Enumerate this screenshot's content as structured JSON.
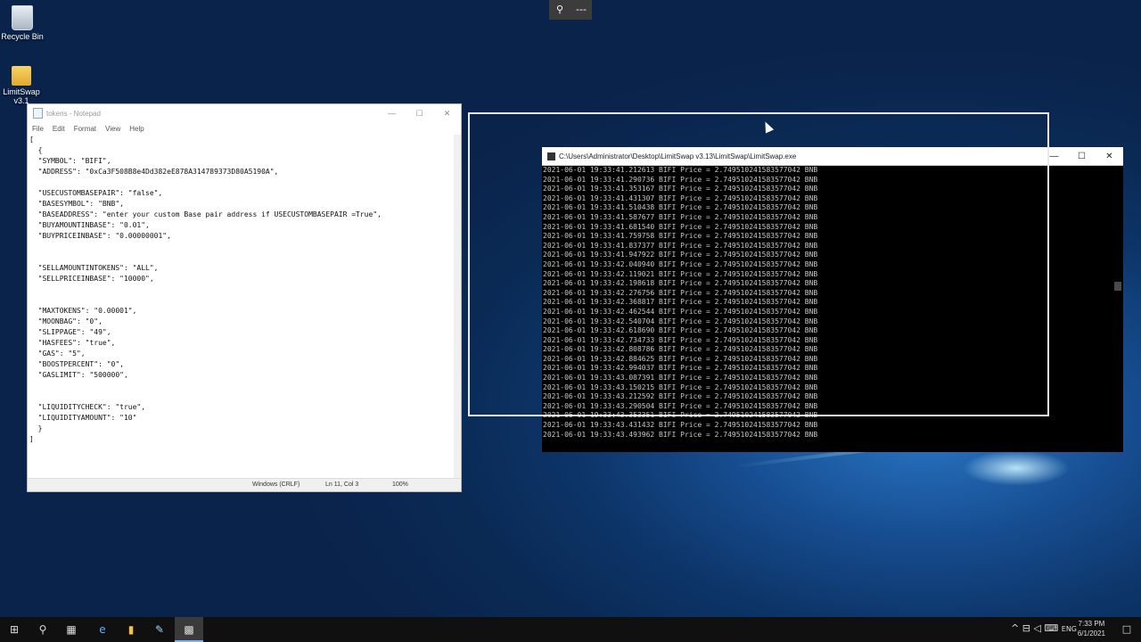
{
  "desktop": {
    "icons": [
      {
        "label": "Recycle Bin"
      },
      {
        "label": "LimitSwap v3.1"
      }
    ]
  },
  "remote_toolbar": {
    "zoom_icon": "zoom-icon",
    "more_label": "---"
  },
  "notepad": {
    "title": "tokens - Notepad",
    "menu": [
      "File",
      "Edit",
      "Format",
      "View",
      "Help"
    ],
    "content": "[\n  {\n  \"SYMBOL\": \"BIFI\",\n  \"ADDRESS\": \"0xCa3F508B8e4Dd382eE878A314789373D80A5190A\",\n\n  \"USECUSTOMBASEPAIR\": \"false\",\n  \"BASESYMBOL\": \"BNB\",\n  \"BASEADDRESS\": \"enter your custom Base pair address if USECUSTOMBASEPAIR =True\",\n  \"BUYAMOUNTINBASE\": \"0.01\",\n  \"BUYPRICEINBASE\": \"0.00000001\",\n\n\n  \"SELLAMOUNTINTOKENS\": \"ALL\",\n  \"SELLPRICEINBASE\": \"10000\",\n\n\n  \"MAXTOKENS\": \"0.00001\",\n  \"MOONBAG\": \"0\",\n  \"SLIPPAGE\": \"49\",\n  \"HASFEES\": \"true\",\n  \"GAS\": \"5\",\n  \"BOOSTPERCENT\": \"0\",\n  \"GASLIMIT\": \"500000\",\n\n\n  \"LIQUIDITYCHECK\": \"true\",\n  \"LIQUIDITYAMOUNT\": \"10\"\n  }\n]",
    "status": {
      "encoding": "Windows (CRLF)",
      "position": "Ln 11, Col 3",
      "zoom": "100%"
    }
  },
  "console": {
    "title": "C:\\Users\\Administrator\\Desktop\\LimitSwap v3.13\\LimitSwap\\LimitSwap.exe",
    "lines": "2021-06-01 19:33:41.212613 BIFI Price = 2.749510241583577042 BNB\n2021-06-01 19:33:41.290736 BIFI Price = 2.749510241583577042 BNB\n2021-06-01 19:33:41.353167 BIFI Price = 2.749510241583577042 BNB\n2021-06-01 19:33:41.431307 BIFI Price = 2.749510241583577042 BNB\n2021-06-01 19:33:41.510438 BIFI Price = 2.749510241583577042 BNB\n2021-06-01 19:33:41.587677 BIFI Price = 2.749510241583577042 BNB\n2021-06-01 19:33:41.681540 BIFI Price = 2.749510241583577042 BNB\n2021-06-01 19:33:41.759758 BIFI Price = 2.749510241583577042 BNB\n2021-06-01 19:33:41.837377 BIFI Price = 2.749510241583577042 BNB\n2021-06-01 19:33:41.947922 BIFI Price = 2.749510241583577042 BNB\n2021-06-01 19:33:42.040940 BIFI Price = 2.749510241583577042 BNB\n2021-06-01 19:33:42.119021 BIFI Price = 2.749510241583577042 BNB\n2021-06-01 19:33:42.198618 BIFI Price = 2.749510241583577042 BNB\n2021-06-01 19:33:42.276756 BIFI Price = 2.749510241583577042 BNB\n2021-06-01 19:33:42.368817 BIFI Price = 2.749510241583577042 BNB\n2021-06-01 19:33:42.462544 BIFI Price = 2.749510241583577042 BNB\n2021-06-01 19:33:42.540704 BIFI Price = 2.749510241583577042 BNB\n2021-06-01 19:33:42.618690 BIFI Price = 2.749510241583577042 BNB\n2021-06-01 19:33:42.734733 BIFI Price = 2.749510241583577042 BNB\n2021-06-01 19:33:42.808786 BIFI Price = 2.749510241583577042 BNB\n2021-06-01 19:33:42.884625 BIFI Price = 2.749510241583577042 BNB\n2021-06-01 19:33:42.994037 BIFI Price = 2.749510241583577042 BNB\n2021-06-01 19:33:43.087391 BIFI Price = 2.749510241583577042 BNB\n2021-06-01 19:33:43.150215 BIFI Price = 2.749510241583577042 BNB\n2021-06-01 19:33:43.212592 BIFI Price = 2.749510241583577042 BNB\n2021-06-01 19:33:43.290504 BIFI Price = 2.749510241583577042 BNB\n2021-06-01 19:33:43.353351 BIFI Price = 2.749510241583577042 BNB\n2021-06-01 19:33:43.431432 BIFI Price = 2.749510241583577042 BNB\n2021-06-01 19:33:43.493962 BIFI Price = 2.749510241583577042 BNB"
  },
  "window_buttons": {
    "minimize": "—",
    "maximize": "☐",
    "close": "✕"
  },
  "taskbar": {
    "clock_time": "7:33 PM",
    "clock_date": "6/1/2021",
    "tray_glyphs": "^ ⊟ ◁ ⌨",
    "tray_text": "ENG"
  },
  "colors": {
    "accent": "#6fb6ff",
    "console_text": "#c8c8c8",
    "taskbar": "#101010"
  }
}
